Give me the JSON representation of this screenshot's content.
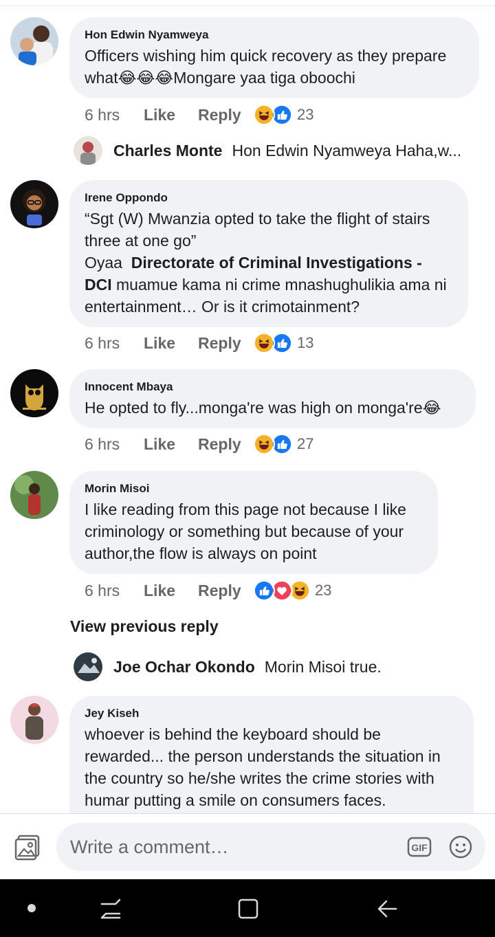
{
  "comments": [
    {
      "author": "Hon Edwin Nyamweya",
      "text": "Officers wishing him quick recovery as they prepare what😂😂😂Mongare yaa tiga oboochi",
      "time": "6 hrs",
      "like_label": "Like",
      "reply_label": "Reply",
      "reactions": [
        "haha",
        "like"
      ],
      "reaction_count": "23"
    },
    {
      "author": "Irene Oppondo",
      "text_line1": "“Sgt (W) Mwanzia opted to take the flight of stairs three at one go”",
      "text_prefix": "Oyaa",
      "text_mention": "Directorate of Criminal Investigations - DCI",
      "text_rest": "muamue kama ni crime mnashughulikia ama ni entertainment… Or is it crimotainment?",
      "time": "6 hrs",
      "like_label": "Like",
      "reply_label": "Reply",
      "reactions": [
        "haha",
        "like"
      ],
      "reaction_count": "13"
    },
    {
      "author": "Innocent Mbaya",
      "text": "He opted to fly...monga're was high on monga're😂",
      "time": "6 hrs",
      "like_label": "Like",
      "reply_label": "Reply",
      "reactions": [
        "haha",
        "like"
      ],
      "reaction_count": "27"
    },
    {
      "author": "Morin Misoi",
      "text": "I like reading from this page not because I like criminology or something but because of your author,the flow is always on point",
      "time": "6 hrs",
      "like_label": "Like",
      "reply_label": "Reply",
      "reactions": [
        "like",
        "love",
        "haha"
      ],
      "reaction_count": "23"
    },
    {
      "author": "Jey Kiseh",
      "text": "whoever is behind the keyboard should be rewarded... the person understands the situation in the country so he/she writes the crime stories with humar putting a smile on consumers faces."
    }
  ],
  "replies": [
    {
      "author": "Charles Monte",
      "text": "Hon Edwin Nyamweya Haha,w..."
    },
    {
      "author": "Joe Ochar Okondo",
      "text": "Morin Misoi true."
    }
  ],
  "view_previous_reply": "View previous reply",
  "composer": {
    "placeholder": "Write a comment…",
    "gif_label": "GIF"
  },
  "colors": {
    "bubble": "#f0f2f5",
    "meta_text": "#65676b",
    "like_blue": "#1877f2",
    "love_red": "#f33e58",
    "haha_yellow": "#f7b125"
  }
}
